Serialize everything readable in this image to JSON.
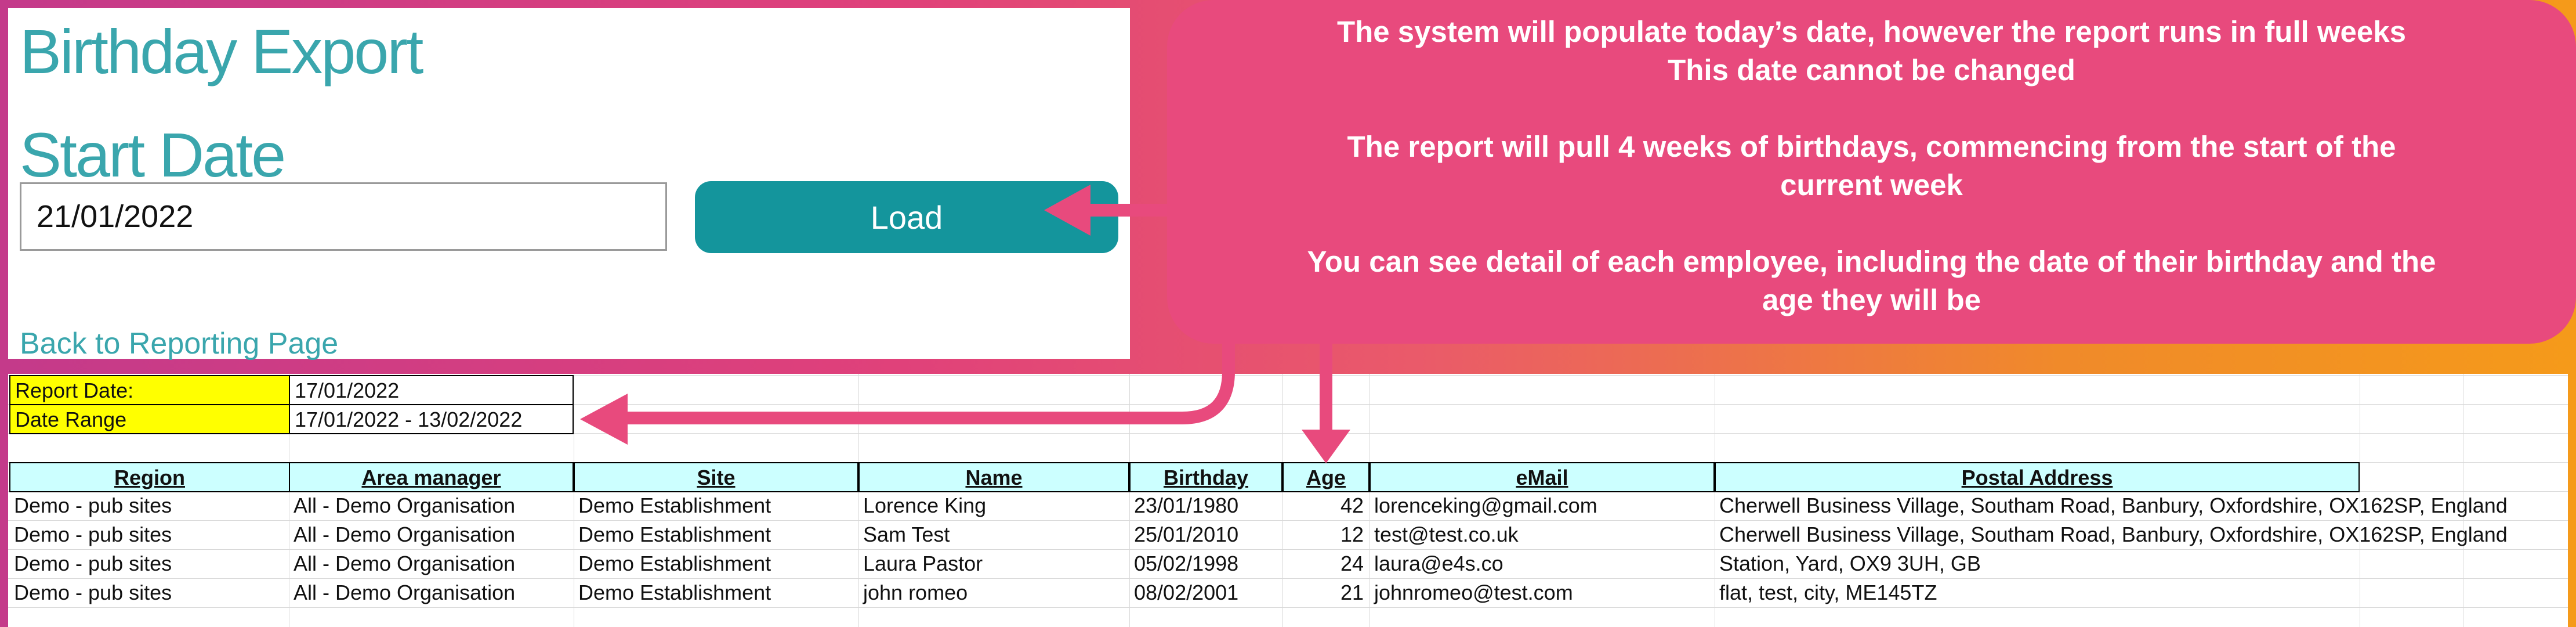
{
  "app": {
    "title": "Birthday Export",
    "start_date_label": "Start Date",
    "start_date_value": "21/01/2022",
    "load_label": "Load",
    "back_link": "Back to Reporting Page"
  },
  "callout": {
    "line1": "The system will populate today’s date, however the report runs in full weeks",
    "line2": "This date cannot be changed",
    "line3": "The report will pull 4 weeks of birthdays, commencing from the start of the",
    "line4": "current week",
    "line5": "You can see detail of each employee, including the date of their birthday and the",
    "line6": "age they will be"
  },
  "report": {
    "report_date_label": "Report Date:",
    "report_date_value": "17/01/2022",
    "date_range_label": "Date Range",
    "date_range_value": "17/01/2022 - 13/02/2022"
  },
  "table": {
    "headers": [
      "Region",
      "Area manager",
      "Site",
      "Name",
      "Birthday",
      "Age",
      "eMail",
      "Postal Address"
    ],
    "rows": [
      [
        "Demo - pub sites",
        "All - Demo Organisation",
        "Demo Establishment",
        "Lorence King",
        "23/01/1980",
        "42",
        "lorenceking@gmail.com",
        "Cherwell Business Village, Southam Road, Banbury, Oxfordshire, OX162SP, England"
      ],
      [
        "Demo - pub sites",
        "All - Demo Organisation",
        "Demo Establishment",
        "Sam Test",
        "25/01/2010",
        "12",
        "test@test.co.uk",
        "Cherwell Business Village, Southam Road, Banbury, Oxfordshire, OX162SP, England"
      ],
      [
        "Demo - pub sites",
        "All - Demo Organisation",
        "Demo Establishment",
        "Laura Pastor",
        "05/02/1998",
        "24",
        "laura@e4s.co",
        "Station, Yard, OX9 3UH, GB"
      ],
      [
        "Demo - pub sites",
        "All - Demo Organisation",
        "Demo Establishment",
        "john romeo",
        "08/02/2001",
        "21",
        "johnromeo@test.com",
        "flat, test, city, ME145TZ"
      ]
    ]
  },
  "colors": {
    "accent_teal": "#14959c",
    "title_teal": "#3aa6ad",
    "callout_pink": "#e84a7d",
    "highlight_yellow": "#ffff00",
    "header_cyan": "#ccffff"
  }
}
